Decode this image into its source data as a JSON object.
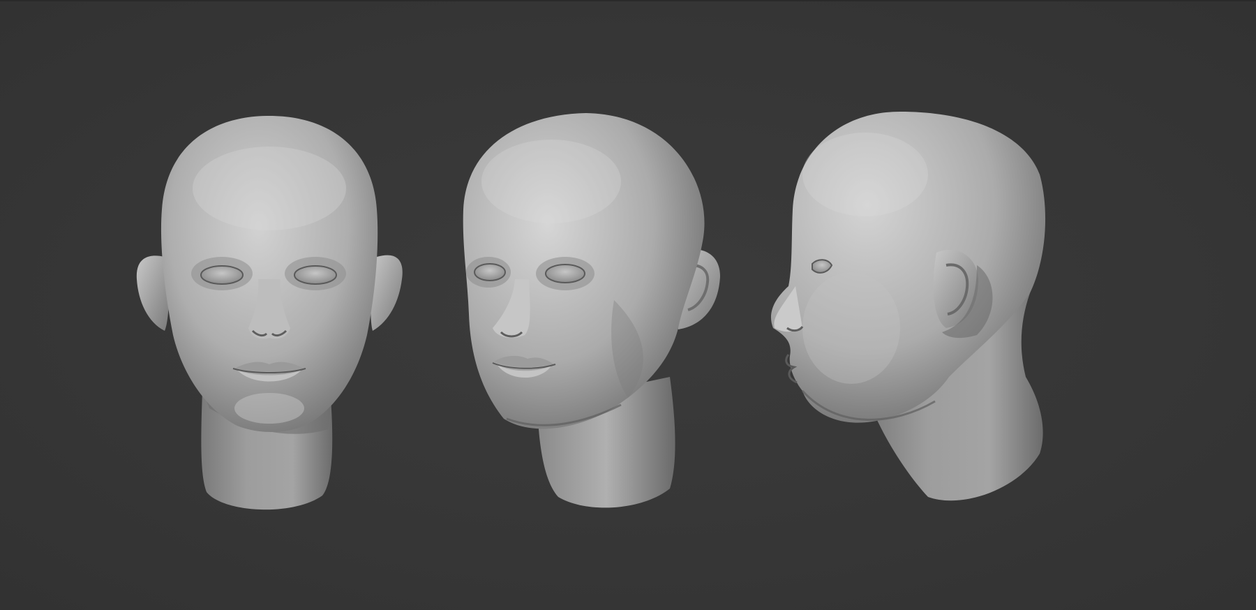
{
  "scene": {
    "background_color": "#373737",
    "clay_color": "#a9a9a9",
    "views": [
      {
        "name": "front",
        "icon": "head-front-view"
      },
      {
        "name": "three-quarter",
        "icon": "head-three-quarter-view"
      },
      {
        "name": "profile",
        "icon": "head-profile-view"
      }
    ]
  }
}
